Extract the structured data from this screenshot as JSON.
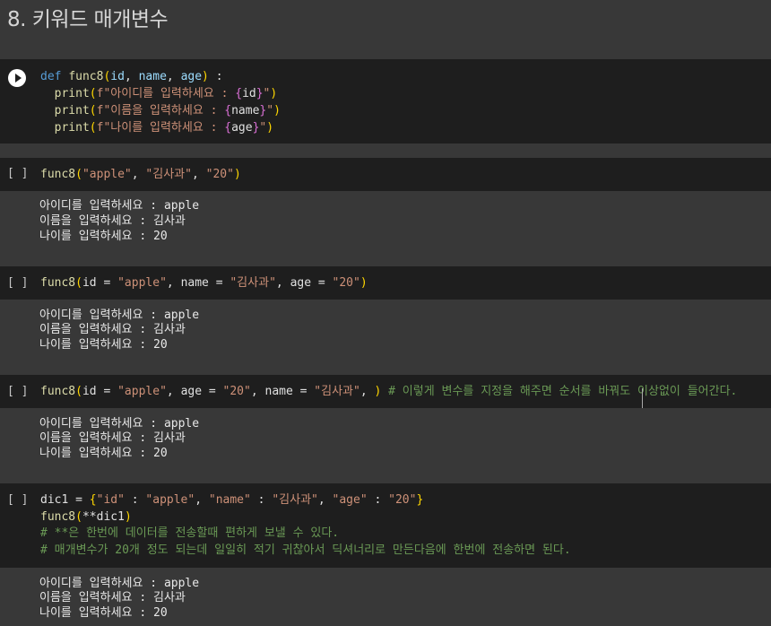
{
  "heading": "8. 키워드 매개변수",
  "gutter_label": "[ ]",
  "cell1": {
    "def": "def",
    "fn": "func8",
    "params": [
      "id",
      "name",
      "age"
    ],
    "colon": " :",
    "prints": [
      {
        "fn": "print",
        "prefix": "f\"아이디를 입력하세요 : ",
        "var": "id"
      },
      {
        "fn": "print",
        "prefix": "f\"이름을 입력하세요 : ",
        "var": "name"
      },
      {
        "fn": "print",
        "prefix": "f\"나이를 입력하세요 : ",
        "var": "age"
      }
    ]
  },
  "cell2": {
    "fn": "func8",
    "args": [
      "\"apple\"",
      "\"김사과\"",
      "\"20\""
    ],
    "output": [
      "아이디를 입력하세요 : apple",
      "이름을 입력하세요 : 김사과",
      "나이를 입력하세요 : 20"
    ]
  },
  "cell3": {
    "fn": "func8",
    "kwargs": [
      {
        "k": "id",
        "v": "\"apple\""
      },
      {
        "k": "name",
        "v": "\"김사과\""
      },
      {
        "k": "age",
        "v": "\"20\""
      }
    ],
    "output": [
      "아이디를 입력하세요 : apple",
      "이름을 입력하세요 : 김사과",
      "나이를 입력하세요 : 20"
    ]
  },
  "cell4": {
    "fn": "func8",
    "kwargs": [
      {
        "k": "id",
        "v": "\"apple\""
      },
      {
        "k": "age",
        "v": "\"20\""
      },
      {
        "k": "name",
        "v": "\"김사과\""
      }
    ],
    "comment": "# 이렇게 변수를 지정을 해주면 순서를 바꿔도 이상없이 들어간다.",
    "output": [
      "아이디를 입력하세요 : apple",
      "이름을 입력하세요 : 김사과",
      "나이를 입력하세요 : 20"
    ]
  },
  "cell5": {
    "var": "dic1",
    "dict": [
      {
        "k": "\"id\"",
        "v": "\"apple\""
      },
      {
        "k": "\"name\"",
        "v": "\"김사과\""
      },
      {
        "k": "\"age\"",
        "v": "\"20\""
      }
    ],
    "call_fn": "func8",
    "call_arg": "**dic1",
    "comment1": "# **은 한번에 데이터를 전송할때 편하게 보낼 수 있다.",
    "comment2": "# 매개변수가 20개 정도 되는데 일일히 적기 귀찮아서 딕셔너리로 만든다음에 한번에 전송하면 된다.",
    "output": [
      "아이디를 입력하세요 : apple",
      "이름을 입력하세요 : 김사과",
      "나이를 입력하세요 : 20"
    ]
  }
}
